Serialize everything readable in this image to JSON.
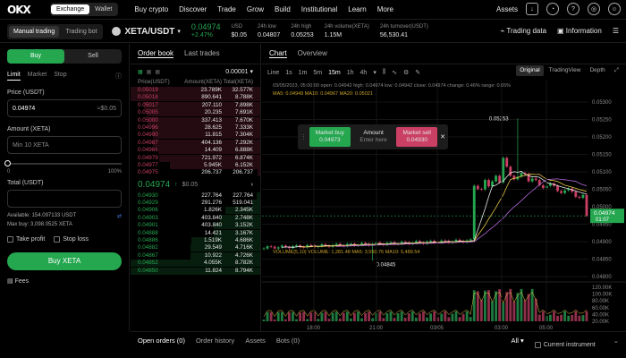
{
  "nav": {
    "logo": "OKX",
    "exchange": "Exchange",
    "wallet": "Wallet",
    "items": [
      "Buy crypto",
      "Discover",
      "Trade",
      "Grow",
      "Build",
      "Institutional",
      "Learn",
      "More"
    ],
    "assets": "Assets"
  },
  "ticker": {
    "mode_manual": "Manual trading",
    "mode_bot": "Trading bot",
    "pair": "XETA/USDT",
    "price": "0.04974",
    "change": "+2.47%",
    "usd_label": "USD",
    "usd": "$0.05",
    "low_label": "24h low",
    "low": "0.04807",
    "high_label": "24h high",
    "high": "0.05253",
    "vol_label": "24h volume(XETA)",
    "vol": "1.15M",
    "turn_label": "24h turnover(USDT)",
    "turn": "56,530.41",
    "trading_data": "Trading data",
    "information": "Information"
  },
  "order": {
    "buy": "Buy",
    "sell": "Sell",
    "types": [
      "Limit",
      "Market",
      "Stop"
    ],
    "price_label": "Price (USDT)",
    "price": "0.04974",
    "price_hint": "≈$0.05",
    "amount_label": "Amount (XETA)",
    "amount_ph": "Min 10 XETA",
    "r0": "0",
    "r100": "100%",
    "total_label": "Total (USDT)",
    "available": "Available: 154.097133 USDT",
    "maxbuy": "Max buy: 3,098.0525 XETA",
    "take_profit": "Take profit",
    "stop_loss": "Stop loss",
    "buy_button": "Buy XETA",
    "fees": "Fees"
  },
  "orderbook": {
    "tab1": "Order book",
    "tab2": "Last trades",
    "precision": "0.00001",
    "h1": "Price(USDT)",
    "h2": "Amount(XETA)",
    "h3": "Total(XETA)",
    "asks": [
      [
        "0.05019",
        "23.789K",
        "32.577K"
      ],
      [
        "0.05018",
        "890.641",
        "8.788K"
      ],
      [
        "0.05017",
        "207.110",
        "7.898K"
      ],
      [
        "0.05005",
        "20.235",
        "7.691K"
      ],
      [
        "0.05000",
        "337.413",
        "7.670K"
      ],
      [
        "0.04996",
        "28.625",
        "7.333K"
      ],
      [
        "0.04990",
        "11.815",
        "7.304K"
      ],
      [
        "0.04987",
        "404.136",
        "7.292K"
      ],
      [
        "0.04986",
        "14.409",
        "6.888K"
      ],
      [
        "0.04979",
        "721.972",
        "6.874K"
      ],
      [
        "0.04977",
        "5.945K",
        "6.152K"
      ],
      [
        "0.04975",
        "206.737",
        "206.737"
      ]
    ],
    "mid": "0.04974",
    "mid_usd": "$0.05",
    "bids": [
      [
        "0.04930",
        "227.764",
        "227.764"
      ],
      [
        "0.04929",
        "291.276",
        "519.041"
      ],
      [
        "0.04906",
        "1.826K",
        "2.345K"
      ],
      [
        "0.04903",
        "403.840",
        "2.748K"
      ],
      [
        "0.04901",
        "403.840",
        "3.152K"
      ],
      [
        "0.04888",
        "14.421",
        "3.167K"
      ],
      [
        "0.04886",
        "1.519K",
        "4.686K"
      ],
      [
        "0.04882",
        "29.549",
        "4.716K"
      ],
      [
        "0.04867",
        "10.922",
        "4.726K"
      ],
      [
        "0.04852",
        "4.055K",
        "8.782K"
      ],
      [
        "0.04850",
        "11.824",
        "8.794K"
      ]
    ]
  },
  "chart": {
    "tab1": "Chart",
    "tab2": "Overview",
    "line": "Line",
    "intervals": [
      "1s",
      "1m",
      "5m",
      "15m",
      "1h",
      "4h"
    ],
    "active": "15m",
    "views": [
      "Original",
      "TradingView",
      "Depth"
    ],
    "ohlc": "03/05/2023, 05:00:00  open: 0.04942  high: 0.04974  low: 0.04942  close: 0.04974  change: 0.46%  range: 0.65%",
    "ma": "MA5: 0.04949  MA10: 0.04967  MA20: 0.05021",
    "hi_mark": "0.05253",
    "lo_mark": "0.04845",
    "price_axis": [
      "0.05300",
      "0.05250",
      "0.05200",
      "0.05150",
      "0.05100",
      "0.05050",
      "0.05000",
      "0.04950",
      "0.04900",
      "0.04850",
      "0.04800"
    ],
    "last_price": "0.04974",
    "countdown": "01:07",
    "vol_label": "VOLUME(5,10)  VOLUME: 1,281.48  MA5: 3,550.76  MA10: 5,489.54",
    "vol_axis": [
      "120.00K",
      "100.00K",
      "80.00K",
      "60.00K",
      "40.00K",
      "20.00K"
    ],
    "time_axis": [
      "18:00",
      "21:00",
      "03/05",
      "03:00",
      "05:00"
    ],
    "popup": {
      "mb": "Market buy",
      "mb_v": "0.04973",
      "amt": "Amount",
      "amt_ph": "Enter here",
      "ms": "Market sell",
      "ms_v": "0.04930"
    }
  },
  "bottom": {
    "tabs": [
      "Open orders (0)",
      "Order history",
      "Assets",
      "Bots (0)"
    ],
    "all": "All",
    "current": "Current instrument"
  }
}
